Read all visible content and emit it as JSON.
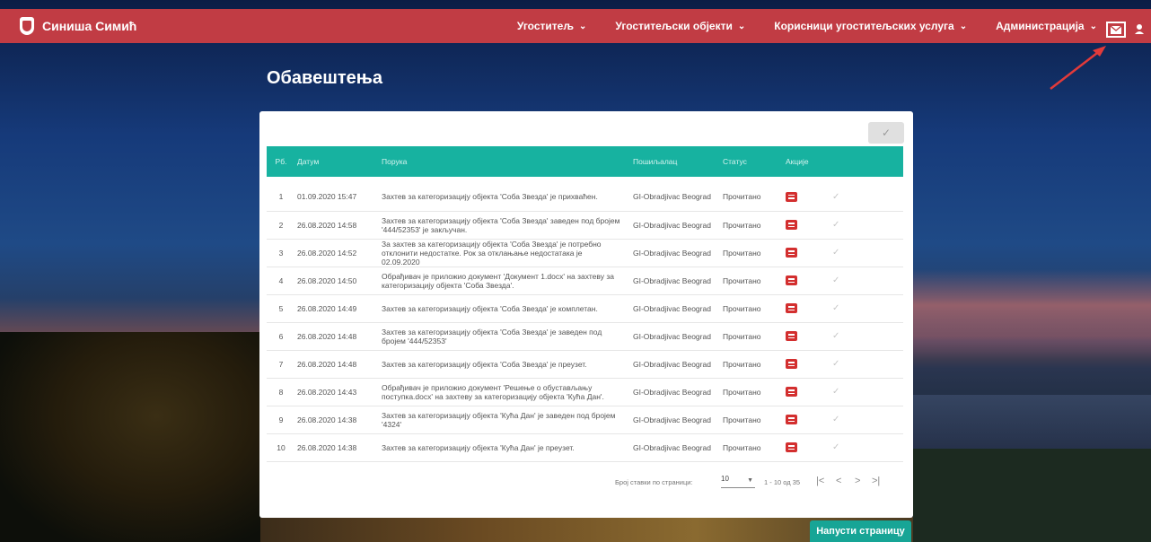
{
  "header": {
    "user_name": "Синиша Симић",
    "nav": [
      {
        "label": "Угоститељ"
      },
      {
        "label": "Угоститељски објекти"
      },
      {
        "label": "Корисници угоститељских услуга"
      },
      {
        "label": "Администрација"
      }
    ]
  },
  "page_title": "Обавештења",
  "table": {
    "columns": [
      "Рб.",
      "Датум",
      "Порука",
      "Пошиљалац",
      "Статус",
      "Акције"
    ],
    "rows": [
      {
        "no": "1",
        "date": "01.09.2020 15:47",
        "message": "Захтев за категоризацију објекта 'Соба Звезда' је прихваћен.",
        "sender": "GI-Obradjivac Beograd",
        "status": "Прочитано"
      },
      {
        "no": "2",
        "date": "26.08.2020 14:58",
        "message": "Захтев за категоризацију објекта 'Соба Звезда' заведен под бројем '444/52353' је закључан.",
        "sender": "GI-Obradjivac Beograd",
        "status": "Прочитано"
      },
      {
        "no": "3",
        "date": "26.08.2020 14:52",
        "message": "За захтев за категоризацију објекта 'Соба Звезда' је потребно отклонити недостатке. Рок за отклањање недостатака је 02.09.2020",
        "sender": "GI-Obradjivac Beograd",
        "status": "Прочитано"
      },
      {
        "no": "4",
        "date": "26.08.2020 14:50",
        "message": "Обрађивач је приложио документ 'Документ 1.docx' на захтеву за категоризацију објекта 'Соба Звезда'.",
        "sender": "GI-Obradjivac Beograd",
        "status": "Прочитано"
      },
      {
        "no": "5",
        "date": "26.08.2020 14:49",
        "message": "Захтев за категоризацију објекта 'Соба Звезда' је комплетан.",
        "sender": "GI-Obradjivac Beograd",
        "status": "Прочитано"
      },
      {
        "no": "6",
        "date": "26.08.2020 14:48",
        "message": "Захтев за категоризацију објекта 'Соба Звезда' је заведен под бројем '444/52353'",
        "sender": "GI-Obradjivac Beograd",
        "status": "Прочитано"
      },
      {
        "no": "7",
        "date": "26.08.2020 14:48",
        "message": "Захтев за категоризацију објекта 'Соба Звезда' је преузет.",
        "sender": "GI-Obradjivac Beograd",
        "status": "Прочитано"
      },
      {
        "no": "8",
        "date": "26.08.2020 14:43",
        "message": "Обрађивач је приложио документ 'Решење о обустављању поступка.docx' на захтеву за категоризацију објекта 'Кућа Дан'.",
        "sender": "GI-Obradjivac Beograd",
        "status": "Прочитано"
      },
      {
        "no": "9",
        "date": "26.08.2020 14:38",
        "message": "Захтев за категоризацију објекта 'Кућа Дан' је заведен под бројем '4324'",
        "sender": "GI-Obradjivac Beograd",
        "status": "Прочитано"
      },
      {
        "no": "10",
        "date": "26.08.2020 14:38",
        "message": "Захтев за категоризацију објекта 'Кућа Дан' је преузет.",
        "sender": "GI-Obradjivac Beograd",
        "status": "Прочитано"
      }
    ]
  },
  "pager": {
    "items_per_page_label": "Број ставки по страници:",
    "page_size": "10",
    "range": "1 - 10 од 35"
  },
  "leave_button": "Напусти страницу",
  "colors": {
    "topbar": "#c13c44",
    "table_header": "#17b2a0",
    "button": "#17a596",
    "doc_icon": "#d32f2f"
  },
  "icons": {
    "mail": "envelope-icon",
    "user": "user-icon",
    "row_action": "document-icon",
    "read": "check-icon"
  }
}
